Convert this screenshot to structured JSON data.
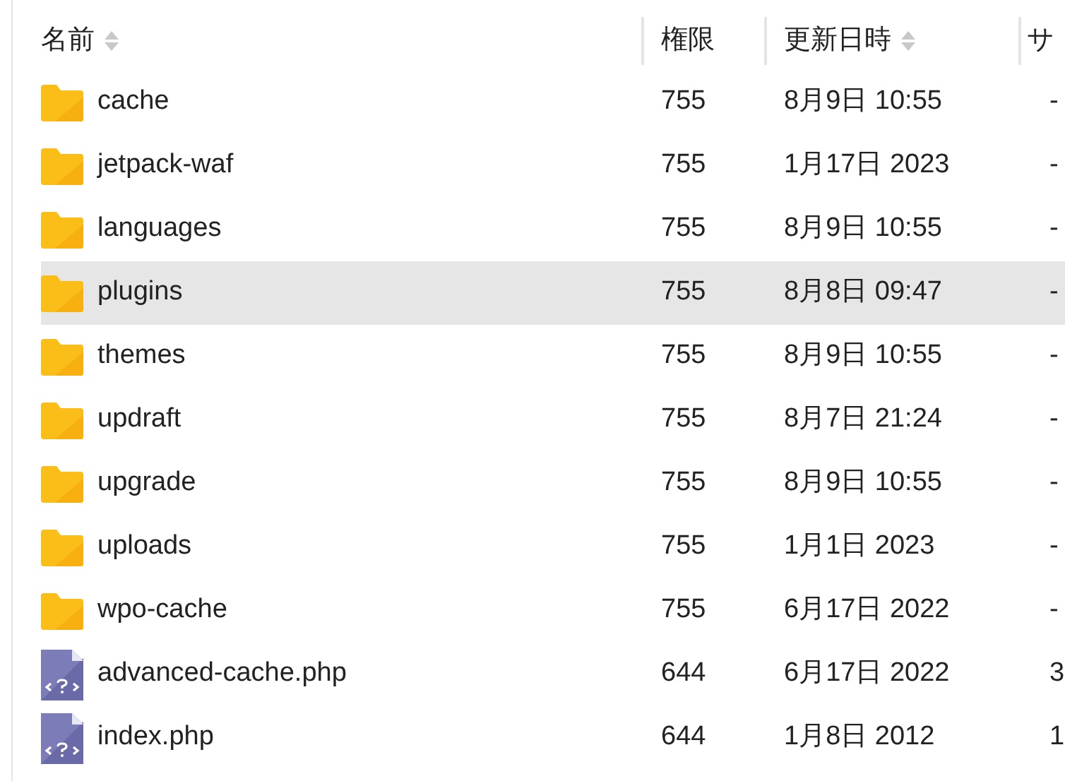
{
  "table": {
    "columns": [
      {
        "label": "名前",
        "sortable": true
      },
      {
        "label": "権限",
        "sortable": false
      },
      {
        "label": "更新日時",
        "sortable": true
      },
      {
        "label": "サ",
        "sortable": false
      }
    ],
    "rows": [
      {
        "kind": "folder",
        "name": "cache",
        "perm": "755",
        "modified": "8月9日 10:55",
        "size": "-",
        "selected": false
      },
      {
        "kind": "folder",
        "name": "jetpack-waf",
        "perm": "755",
        "modified": "1月17日 2023",
        "size": "-",
        "selected": false
      },
      {
        "kind": "folder",
        "name": "languages",
        "perm": "755",
        "modified": "8月9日 10:55",
        "size": "-",
        "selected": false
      },
      {
        "kind": "folder",
        "name": "plugins",
        "perm": "755",
        "modified": "8月8日 09:47",
        "size": "-",
        "selected": true
      },
      {
        "kind": "folder",
        "name": "themes",
        "perm": "755",
        "modified": "8月9日 10:55",
        "size": "-",
        "selected": false
      },
      {
        "kind": "folder",
        "name": "updraft",
        "perm": "755",
        "modified": "8月7日 21:24",
        "size": "-",
        "selected": false
      },
      {
        "kind": "folder",
        "name": "upgrade",
        "perm": "755",
        "modified": "8月9日 10:55",
        "size": "-",
        "selected": false
      },
      {
        "kind": "folder",
        "name": "uploads",
        "perm": "755",
        "modified": "1月1日 2023",
        "size": "-",
        "selected": false
      },
      {
        "kind": "folder",
        "name": "wpo-cache",
        "perm": "755",
        "modified": "6月17日 2022",
        "size": "-",
        "selected": false
      },
      {
        "kind": "php",
        "name": "advanced-cache.php",
        "perm": "644",
        "modified": "6月17日 2022",
        "size": "3",
        "selected": false
      },
      {
        "kind": "php",
        "name": "index.php",
        "perm": "644",
        "modified": "1月8日 2012",
        "size": "1",
        "selected": false
      }
    ]
  }
}
